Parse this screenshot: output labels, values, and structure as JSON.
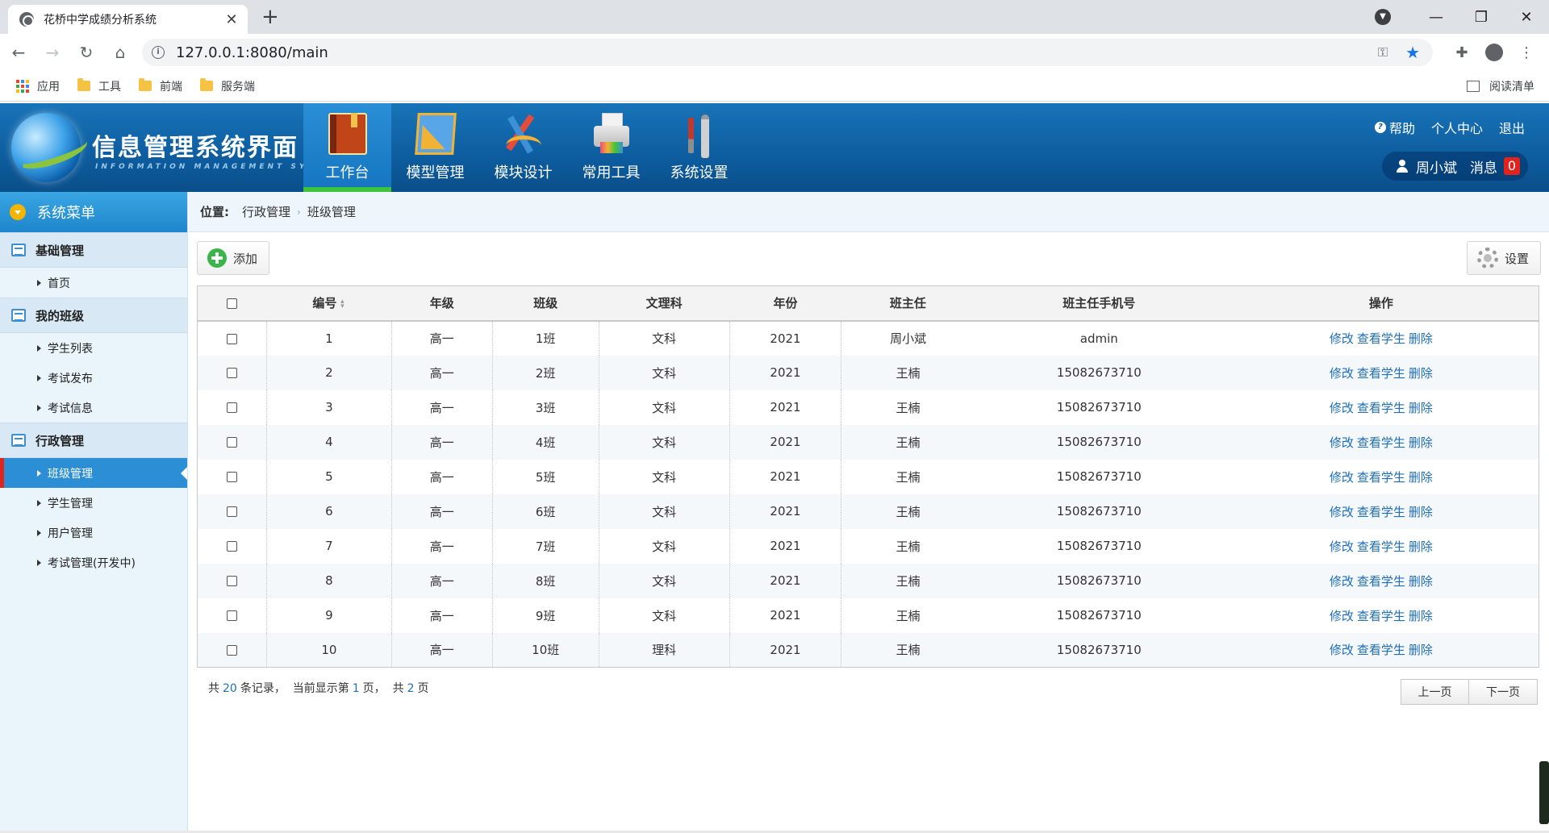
{
  "browser": {
    "tab_title": "花桥中学成绩分析系统",
    "url": "127.0.0.1:8080/main",
    "bookmarks": [
      "应用",
      "工具",
      "前端",
      "服务端"
    ],
    "reading_list": "阅读清单"
  },
  "header": {
    "title": "信息管理系统界面",
    "subtitle": "INFORMATION MANAGEMENT SYSTEM GUI",
    "nav": [
      "工作台",
      "模型管理",
      "模块设计",
      "常用工具",
      "系统设置"
    ],
    "links": {
      "help": "帮助",
      "profile": "个人中心",
      "logout": "退出"
    },
    "user": "周小斌",
    "message_label": "消息",
    "message_count": "0"
  },
  "sidebar": {
    "title": "系统菜单",
    "groups": [
      {
        "label": "基础管理",
        "items": [
          "首页"
        ]
      },
      {
        "label": "我的班级",
        "items": [
          "学生列表",
          "考试发布",
          "考试信息"
        ]
      },
      {
        "label": "行政管理",
        "items": [
          "班级管理",
          "学生管理",
          "用户管理",
          "考试管理(开发中)"
        ]
      }
    ],
    "active_item": "班级管理"
  },
  "breadcrumb": {
    "label": "位置:",
    "items": [
      "行政管理",
      "班级管理"
    ]
  },
  "actions": {
    "add": "添加",
    "settings": "设置"
  },
  "table": {
    "columns": [
      "编号",
      "年级",
      "班级",
      "文理科",
      "年份",
      "班主任",
      "班主任手机号",
      "操作"
    ],
    "ops": [
      "修改",
      "查看学生",
      "删除"
    ],
    "rows": [
      [
        "1",
        "高一",
        "1班",
        "文科",
        "2021",
        "周小斌",
        "admin"
      ],
      [
        "2",
        "高一",
        "2班",
        "文科",
        "2021",
        "王楠",
        "15082673710"
      ],
      [
        "3",
        "高一",
        "3班",
        "文科",
        "2021",
        "王楠",
        "15082673710"
      ],
      [
        "4",
        "高一",
        "4班",
        "文科",
        "2021",
        "王楠",
        "15082673710"
      ],
      [
        "5",
        "高一",
        "5班",
        "文科",
        "2021",
        "王楠",
        "15082673710"
      ],
      [
        "6",
        "高一",
        "6班",
        "文科",
        "2021",
        "王楠",
        "15082673710"
      ],
      [
        "7",
        "高一",
        "7班",
        "文科",
        "2021",
        "王楠",
        "15082673710"
      ],
      [
        "8",
        "高一",
        "8班",
        "文科",
        "2021",
        "王楠",
        "15082673710"
      ],
      [
        "9",
        "高一",
        "9班",
        "文科",
        "2021",
        "王楠",
        "15082673710"
      ],
      [
        "10",
        "高一",
        "10班",
        "理科",
        "2021",
        "王楠",
        "15082673710"
      ]
    ]
  },
  "pager": {
    "total_prefix": "共",
    "total": "20",
    "total_suffix": "条记录，",
    "current_prefix": "当前显示第",
    "current": "1",
    "current_suffix": "页，",
    "pages_prefix": "共",
    "pages": "2",
    "pages_suffix": "页",
    "prev": "上一页",
    "next": "下一页"
  }
}
